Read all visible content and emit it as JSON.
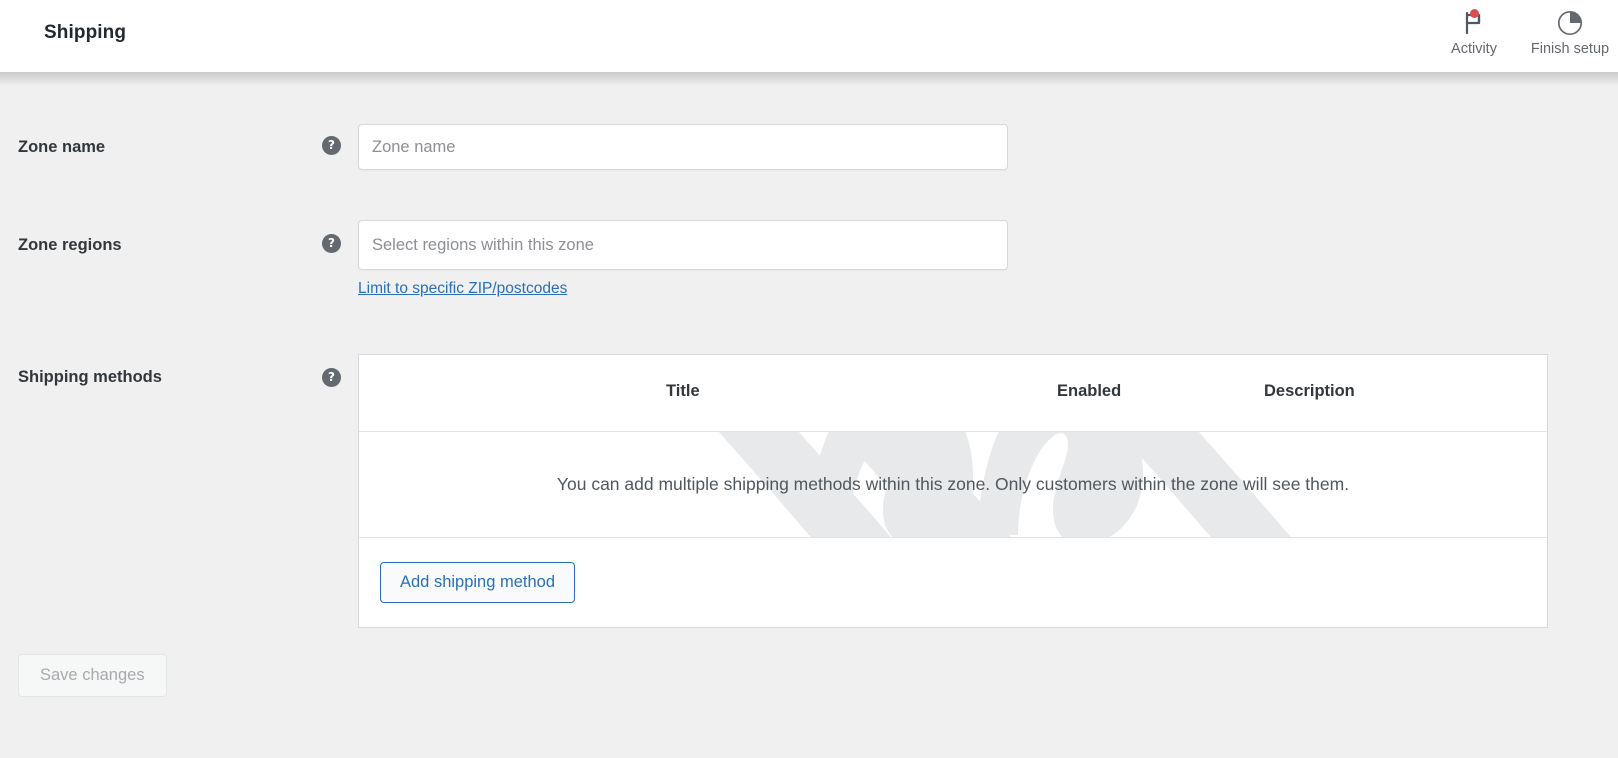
{
  "header": {
    "title": "Shipping",
    "actions": [
      {
        "label": "Activity",
        "icon": "flag-icon",
        "has_badge": true
      },
      {
        "label": "Finish setup",
        "icon": "progress-circle-icon",
        "has_badge": false
      }
    ]
  },
  "form": {
    "help_glyph": "?",
    "rows": [
      {
        "label": "Zone name",
        "input_placeholder": "Zone name",
        "input_value": ""
      },
      {
        "label": "Zone regions",
        "input_placeholder": "Select regions within this zone",
        "input_value": "",
        "link": "Limit to specific ZIP/postcodes"
      },
      {
        "label": "Shipping methods"
      }
    ]
  },
  "methods_table": {
    "columns": [
      "Title",
      "Enabled",
      "Description"
    ],
    "empty_message": "You can add multiple shipping methods within this zone. Only customers within the zone will see them.",
    "add_button": "Add shipping method",
    "watermark": "woocommerce-logo-watermark"
  },
  "footer": {
    "save_button": "Save changes",
    "save_disabled": true
  },
  "colors": {
    "page_background": "#f0f0f1",
    "header_background": "#ffffff",
    "link": "#2b6fb4",
    "badge": "#d94f4f",
    "text_primary": "#32373c",
    "text_secondary": "#50575e",
    "placeholder": "#8c8f94",
    "border": "#d5d8dc"
  }
}
